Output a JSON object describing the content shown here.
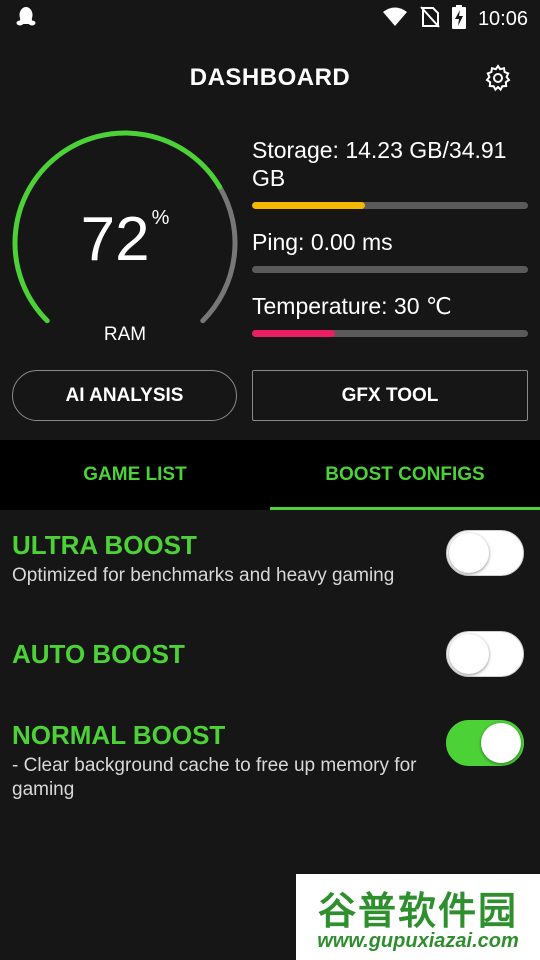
{
  "status_bar": {
    "time": "10:06",
    "icons": [
      "qq-penguin-icon",
      "wifi-icon",
      "no-sim-icon",
      "battery-charging-icon"
    ]
  },
  "header": {
    "title": "DASHBOARD",
    "settings_icon": "gear-icon"
  },
  "gauge": {
    "value": "72",
    "unit": "%",
    "label": "RAM",
    "fraction": 0.72,
    "color": "#4cd137",
    "track_color": "#777777"
  },
  "stats": {
    "storage": {
      "label": "Storage: 14.23 GB/34.91 GB",
      "fraction": 0.41,
      "color": "#f5b800"
    },
    "ping": {
      "label": "Ping: 0.00 ms",
      "fraction": 0.0,
      "color": "#4cd137"
    },
    "temperature": {
      "label": "Temperature: 30 ℃",
      "fraction": 0.3,
      "color": "#e91e63"
    }
  },
  "buttons": {
    "ai_analysis": "AI ANALYSIS",
    "gfx_tool": "GFX TOOL"
  },
  "tabs": [
    {
      "label": "GAME LIST",
      "active": false
    },
    {
      "label": "BOOST CONFIGS",
      "active": true
    }
  ],
  "boosts": [
    {
      "title": "ULTRA BOOST",
      "description": "Optimized for benchmarks and heavy gaming",
      "enabled": false
    },
    {
      "title": "AUTO BOOST",
      "description": "",
      "enabled": false
    },
    {
      "title": "NORMAL BOOST",
      "description": "- Clear background cache to free up memory for gaming",
      "enabled": true
    }
  ],
  "watermark": {
    "text": "谷普软件园",
    "url": "www.gupuxiazai.com"
  },
  "colors": {
    "accent": "#4cd137",
    "background": "#161616",
    "tab_background": "#000000"
  }
}
